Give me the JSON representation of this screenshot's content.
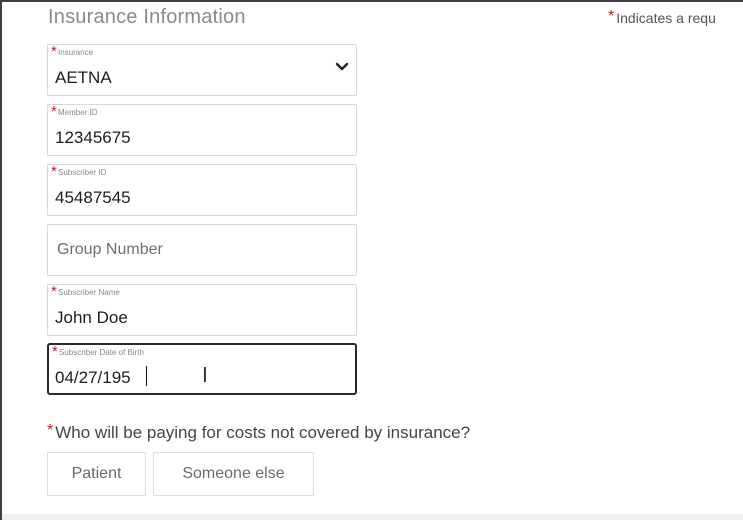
{
  "section": {
    "title": "Insurance Information",
    "required_legend": "Indicates a requ"
  },
  "fields": {
    "insurance": {
      "label": "Insurance",
      "value": "AETNA",
      "icon": "chevron-down-icon"
    },
    "member_id": {
      "label": "Member ID",
      "value": "12345675"
    },
    "subscriber_id": {
      "label": "Subscriber ID",
      "value": "45487545"
    },
    "group_number": {
      "placeholder": "Group Number"
    },
    "subscriber_name": {
      "label": "Subscriber Name",
      "value": "John Doe"
    },
    "subscriber_dob": {
      "label": "Subscriber Date of Birth",
      "value": "04/27/195"
    }
  },
  "payer_question": {
    "text": "Who will be paying for costs not covered by insurance?",
    "options": [
      "Patient",
      "Someone else"
    ]
  },
  "required_marker": "*",
  "colors": {
    "required_star": "#b3262e",
    "active_border": "#2a2a2a"
  }
}
